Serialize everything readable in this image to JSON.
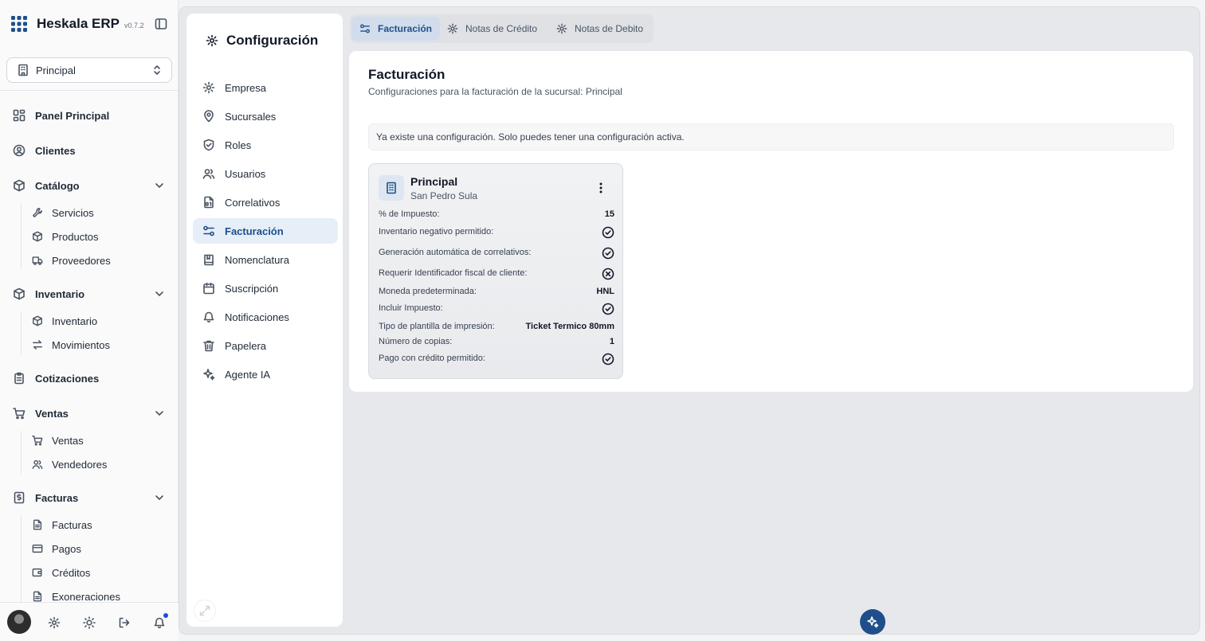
{
  "app": {
    "name": "Heskala ERP",
    "version": "v0.7.2"
  },
  "branch_selector": {
    "value": "Principal"
  },
  "sidebar": {
    "panel": "Panel Principal",
    "clientes": "Clientes",
    "catalogo": {
      "label": "Catálogo",
      "items": [
        "Servicios",
        "Productos",
        "Proveedores"
      ]
    },
    "inventario": {
      "label": "Inventario",
      "items": [
        "Inventario",
        "Movimientos"
      ]
    },
    "cotizaciones": "Cotizaciones",
    "ventas": {
      "label": "Ventas",
      "items": [
        "Ventas",
        "Vendedores"
      ]
    },
    "facturas": {
      "label": "Facturas",
      "items": [
        "Facturas",
        "Pagos",
        "Créditos",
        "Exoneraciones"
      ]
    }
  },
  "config": {
    "title": "Configuración",
    "items": [
      "Empresa",
      "Sucursales",
      "Roles",
      "Usuarios",
      "Correlativos",
      "Facturación",
      "Nomenclatura",
      "Suscripción",
      "Notificaciones",
      "Papelera",
      "Agente IA"
    ],
    "active": "Facturación"
  },
  "tabs": [
    "Facturación",
    "Notas de Crédito",
    "Notas de Debito"
  ],
  "content": {
    "title": "Facturación",
    "subtitle": "Configuraciones para la facturación de la sucursal: Principal",
    "alert": "Ya existe una configuración. Solo puedes tener una configuración activa."
  },
  "branch_card": {
    "name": "Principal",
    "city": "San Pedro Sula",
    "rows": {
      "tax_label": "% de Impuesto:",
      "tax_value": "15",
      "neg_inv_label": "Inventario negativo permitido:",
      "auto_corr_label": "Generación automática de correlativos:",
      "fiscal_id_label": "Requerir Identificador fiscal de cliente:",
      "currency_label": "Moneda predeterminada:",
      "currency_value": "HNL",
      "incl_tax_label": "Incluir Impuesto:",
      "template_label": "Tipo de plantilla de impresión:",
      "template_value": "Ticket Termico 80mm",
      "copies_label": "Número de copias:",
      "copies_value": "1",
      "credit_label": "Pago con crédito permitido:"
    }
  },
  "icons": {
    "accent": "#1e4f8a",
    "check": "check-circle-icon",
    "cross": "x-circle-icon"
  }
}
